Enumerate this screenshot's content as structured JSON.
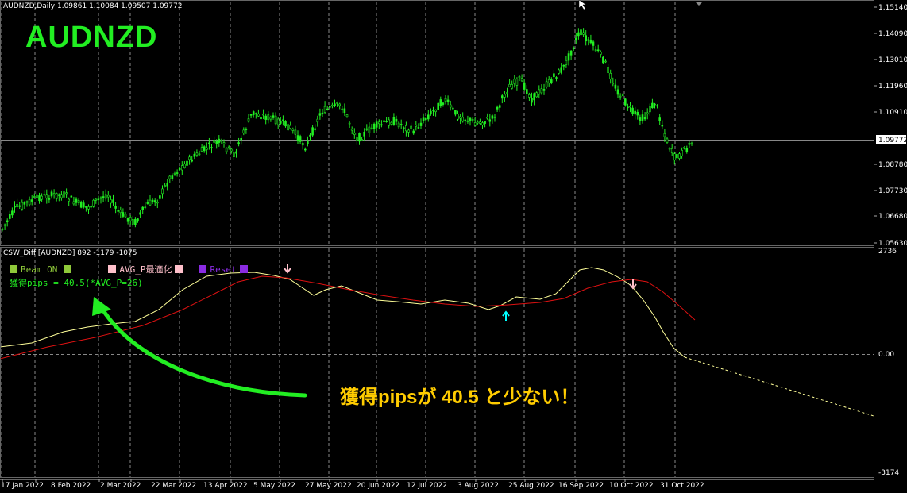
{
  "window": {
    "symbol_header": "AUDNZD,Daily  1.09861 1.10084 1.09507 1.09772"
  },
  "overlay": {
    "symbol_label": "AUDNZD"
  },
  "price_axis": {
    "ticks": [
      "1.15140",
      "1.14090",
      "1.13010",
      "1.11960",
      "1.10910",
      "1.09772",
      "1.08780",
      "1.07730",
      "1.06680",
      "1.05630"
    ],
    "current_price": "1.09772"
  },
  "indicator": {
    "title": "CSW_Diff [AUDNZD]  892 -1179 -1075",
    "axis": {
      "top": "2736",
      "zero": "0.00",
      "bottom": "-3174"
    },
    "controls": [
      {
        "label": "Beam  ON",
        "color": "#8fc93a"
      },
      {
        "label": "AVG_P最適化",
        "color": "#ffc0cb"
      },
      {
        "label": "Reset",
        "color": "#8a2be2"
      }
    ],
    "beam_box_color": "#8fc93a",
    "avg_box_color": "#ffc0cb",
    "reset_box_color": "#8a2be2",
    "pips_text": "獲得pips = 40.5(*AVG_P=26)"
  },
  "annotation": {
    "text": "獲得pipsが 40.5 と少ない！"
  },
  "date_axis": [
    "17 Jan 2022",
    "8 Feb 2022",
    "2 Mar 2022",
    "22 Mar 2022",
    "13 Apr 2022",
    "5 May 2022",
    "27 May 2022",
    "20 Jun 2022",
    "12 Jul 2022",
    "3 Aug 2022",
    "25 Aug 2022",
    "16 Sep 2022",
    "10 Oct 2022",
    "31 Oct 2022"
  ],
  "colors": {
    "candle": "#22ee22",
    "fast_line": "#ffff99",
    "slow_line": "#dd1111",
    "arrow_down": "#ffc0cb",
    "arrow_up": "#00ffff",
    "arrow_big": "#22ee22",
    "annotation": "#ffcc00"
  }
}
